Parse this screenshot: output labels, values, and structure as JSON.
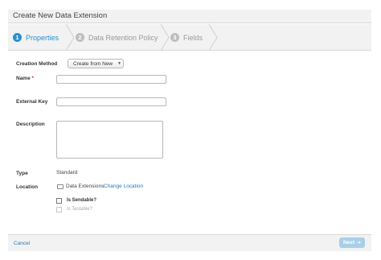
{
  "dialog": {
    "title": "Create New Data Extension"
  },
  "steps": [
    {
      "number": "1",
      "label": "Properties",
      "state": "active"
    },
    {
      "number": "2",
      "label": "Data Retention Policy",
      "state": "inactive"
    },
    {
      "number": "3",
      "label": "Fields",
      "state": "inactive"
    }
  ],
  "form": {
    "creation_method": {
      "label": "Creation Method",
      "value": "Create from New",
      "icon": "caret-down-icon"
    },
    "name": {
      "label": "Name",
      "required_marker": "*",
      "value": ""
    },
    "external_key": {
      "label": "External Key",
      "value": ""
    },
    "description": {
      "label": "Description",
      "value": ""
    },
    "type": {
      "label": "Type",
      "value": "Standard"
    },
    "location": {
      "label": "Location",
      "folder": "Data Extensions",
      "change_link": "Change Location",
      "icon": "folder-icon"
    },
    "is_sendable": {
      "label": "Is Sendable?",
      "checked": false
    },
    "is_testable": {
      "label": "Is Testable?",
      "checked": false,
      "disabled": true
    }
  },
  "footer": {
    "cancel_label": "Cancel",
    "next_label": "Next",
    "next_icon": "arrow-right-icon"
  },
  "colors": {
    "accent": "#2a8fce",
    "link": "#2a7ab8",
    "required": "#c23934",
    "next_disabled": "#a9cfe8"
  }
}
